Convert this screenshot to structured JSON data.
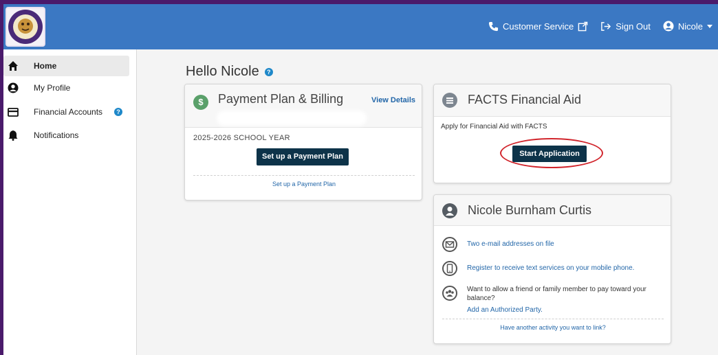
{
  "header": {
    "customer_service": "Customer Service",
    "sign_out": "Sign Out",
    "user": "Nicole",
    "brand_color": "#3b78c3"
  },
  "sidebar": {
    "items": [
      {
        "label": "Home",
        "icon": "home-icon",
        "active": true
      },
      {
        "label": "My Profile",
        "icon": "user-circle-icon"
      },
      {
        "label": "Financial Accounts",
        "icon": "credit-card-icon",
        "help": "?"
      },
      {
        "label": "Notifications",
        "icon": "bell-icon"
      }
    ]
  },
  "main": {
    "greeting": "Hello Nicole",
    "help": "?"
  },
  "payment_card": {
    "icon_text": "$",
    "title": "Payment Plan & Billing",
    "view_details": "View Details",
    "school_year": "2025-2026 SCHOOL YEAR",
    "button": "Set up a Payment Plan",
    "link": "Set up a Payment Plan"
  },
  "aid_card": {
    "title": "FACTS Financial Aid",
    "description": "Apply for Financial Aid with FACTS",
    "button": "Start Application"
  },
  "profile_card": {
    "title": "Nicole Burnham Curtis",
    "rows": [
      {
        "icon": "email-icon",
        "text": "Two e-mail addresses on file"
      },
      {
        "icon": "mobile-phone-icon",
        "text": "Register to receive text services on your mobile phone."
      },
      {
        "icon": "group-icon",
        "text": "Want to allow a friend or family member to pay toward your balance?",
        "link": "Add an Authorized Party."
      }
    ],
    "bottom_link": "Have another activity you want to link?"
  },
  "colors": {
    "button_dark": "#0d3349",
    "link_blue": "#2266a8",
    "highlight_red": "#d1242b"
  }
}
